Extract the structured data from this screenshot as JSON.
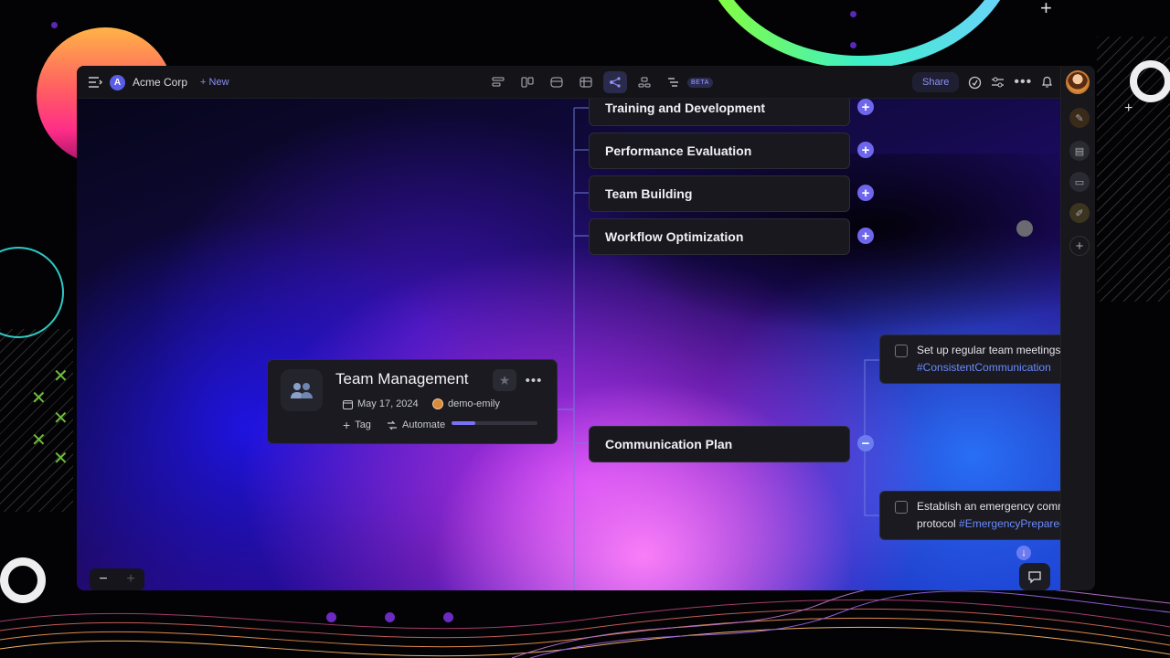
{
  "workspace": {
    "initial": "A",
    "name": "Acme Corp",
    "new_label": "New"
  },
  "toolbar": {
    "views": [
      {
        "icon": "list-view-icon"
      },
      {
        "icon": "board-view-icon"
      },
      {
        "icon": "calendar-view-icon"
      },
      {
        "icon": "table-view-icon"
      },
      {
        "icon": "mindmap-view-icon",
        "active": true
      },
      {
        "icon": "org-chart-view-icon"
      },
      {
        "icon": "gantt-view-icon"
      }
    ],
    "beta_label": "BETA",
    "share_label": "Share"
  },
  "mindmap": {
    "root": {
      "title": "Team Management",
      "date": "May 17, 2024",
      "assignee": "demo-emily",
      "tag_label": "Tag",
      "automate_label": "Automate",
      "progress": 0.28
    },
    "branches": [
      {
        "label": "Training and Development",
        "toggle": "+"
      },
      {
        "label": "Performance Evaluation",
        "toggle": "+"
      },
      {
        "label": "Team Building",
        "toggle": "+"
      },
      {
        "label": "Workflow Optimization",
        "toggle": "+"
      },
      {
        "label": "Communication Plan",
        "toggle": "−"
      }
    ],
    "tasks": [
      {
        "text": "Set up regular team meetings",
        "hashtag": "#ConsistentCommunication"
      },
      {
        "text": "Establish an emergency communication",
        "text2": "protocol",
        "hashtag": "#EmergencyPreparedness"
      }
    ]
  },
  "zoom": {
    "out": "−",
    "in": "+"
  },
  "colors": {
    "accent": "#6f66ee",
    "hashtag": "#6b8bff",
    "panel": "#18181e"
  }
}
